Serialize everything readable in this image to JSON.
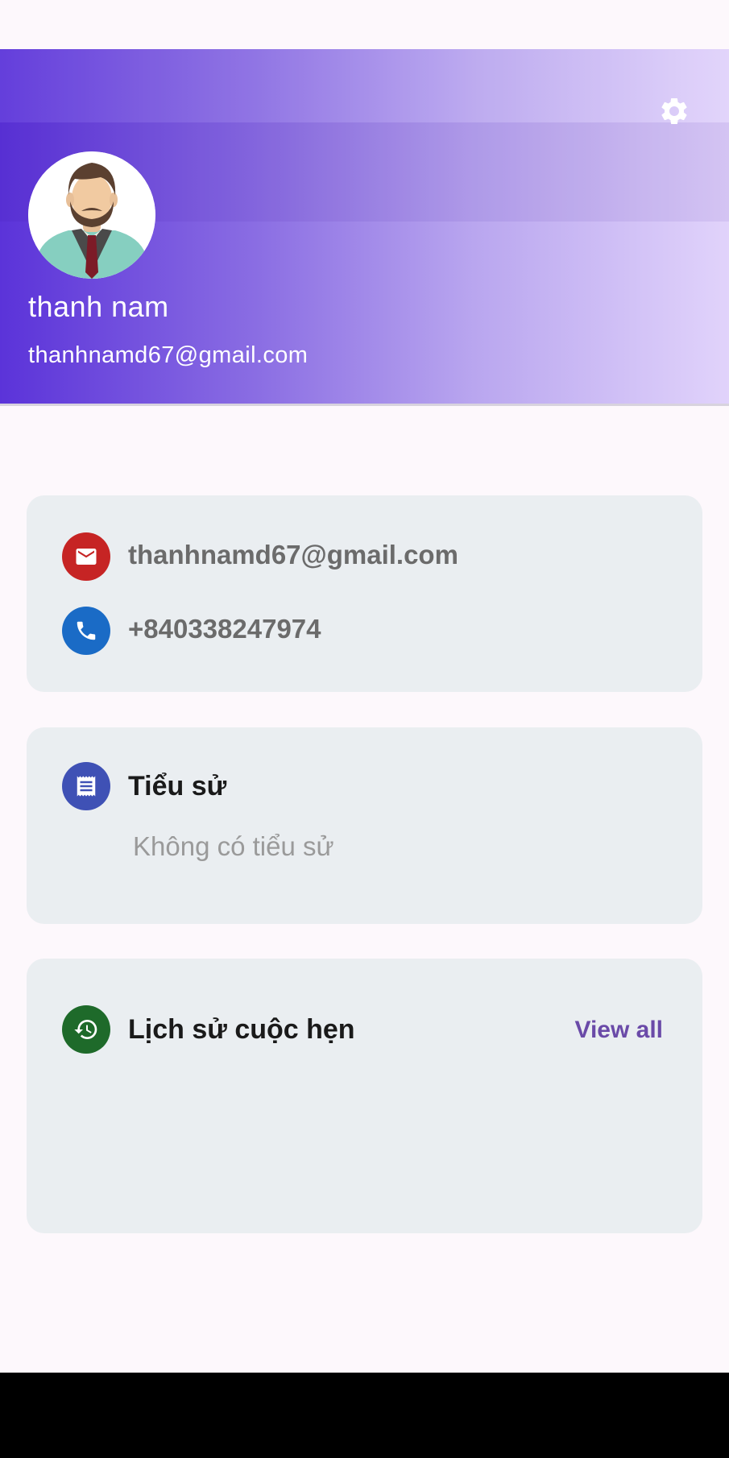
{
  "profile": {
    "name": "thanh nam",
    "email": "thanhnamd67@gmail.com"
  },
  "contact": {
    "email": "thanhnamd67@gmail.com",
    "phone": "+840338247974"
  },
  "bio": {
    "title": "Tiểu sử",
    "empty_text": "Không có tiểu sử"
  },
  "history": {
    "title": "Lịch sử cuộc hẹn",
    "view_all_label": "View all"
  },
  "icons": {
    "settings": "gear-icon",
    "email": "mail-icon",
    "phone": "phone-icon",
    "bio": "receipt-icon",
    "history": "history-icon"
  },
  "colors": {
    "header_gradient_start": "#5b33d9",
    "header_gradient_end": "#e1d3fb",
    "email_icon_bg": "#c62424",
    "phone_icon_bg": "#1a6bc6",
    "bio_icon_bg": "#3f51b5",
    "history_icon_bg": "#1e6a2a",
    "accent": "#6a4aa8"
  }
}
